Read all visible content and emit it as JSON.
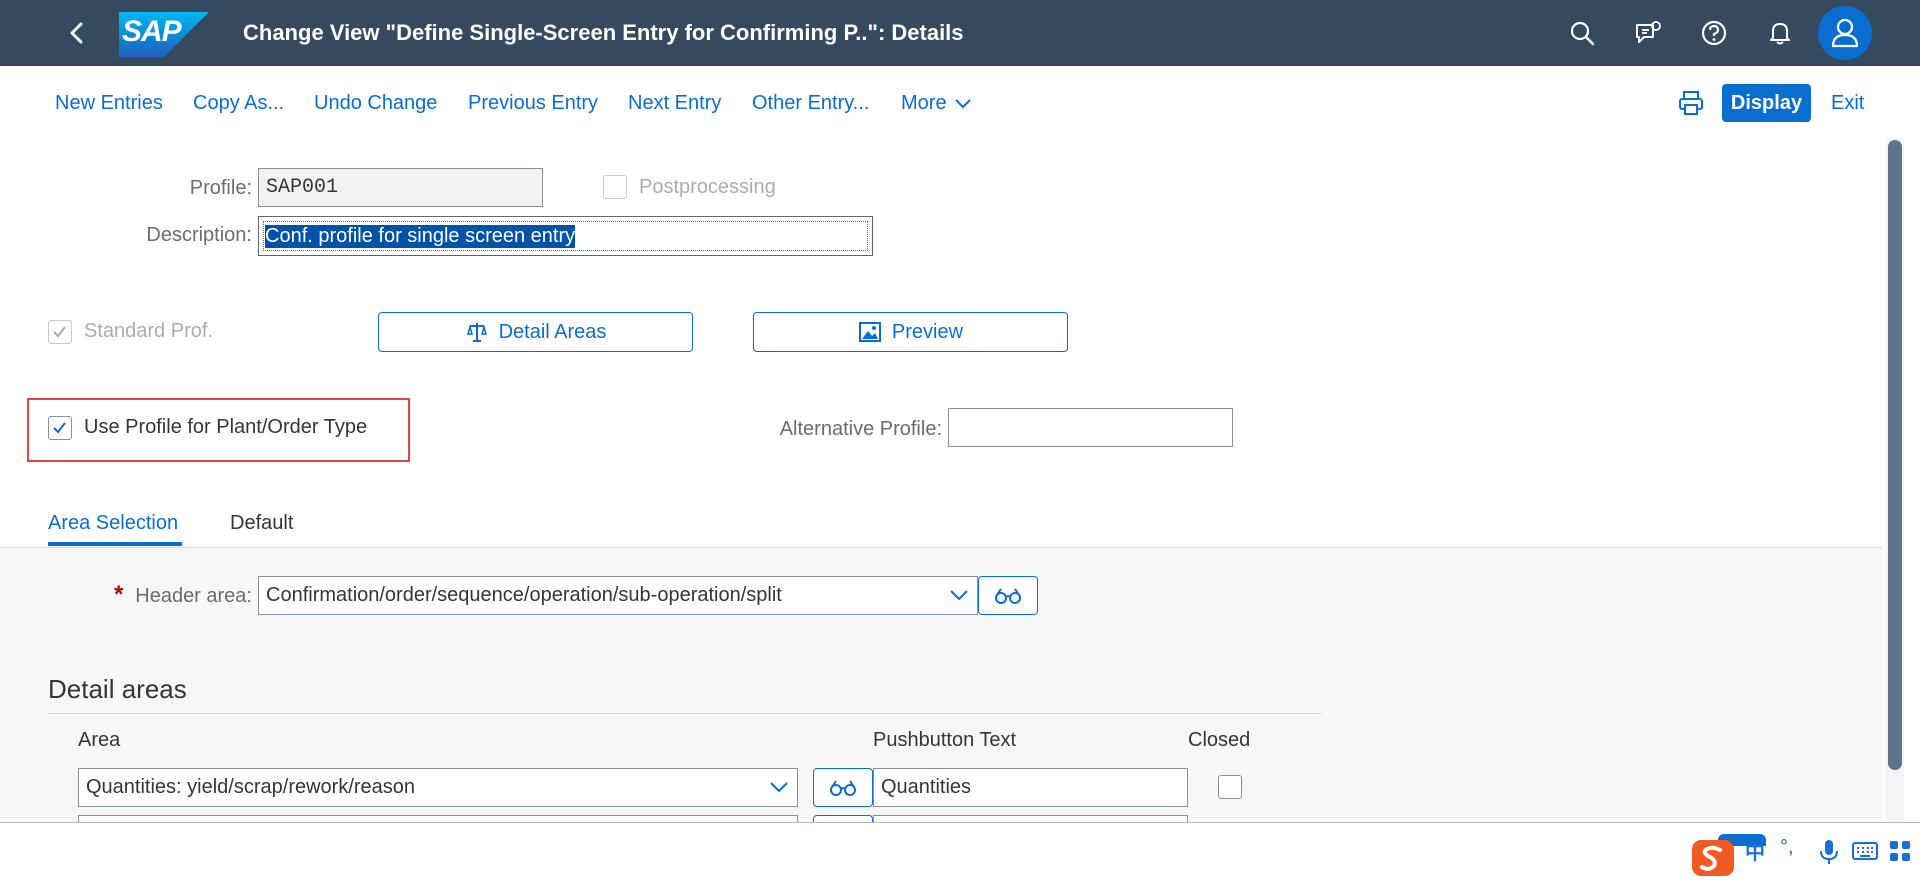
{
  "shell": {
    "logo_text": "SAP",
    "title": "Change View \"Define Single-Screen Entry for Confirming P..\": Details",
    "icons": [
      "back-icon",
      "search-icon",
      "feedback-icon",
      "help-icon",
      "notification-icon",
      "user-icon"
    ]
  },
  "toolbar": {
    "new_entries": "New Entries",
    "copy_as": "Copy As...",
    "undo_change": "Undo Change",
    "previous_entry": "Previous Entry",
    "next_entry": "Next Entry",
    "other_entry": "Other Entry...",
    "more": "More",
    "display": "Display",
    "exit": "Exit"
  },
  "form": {
    "profile_label": "Profile:",
    "profile_value": "SAP001",
    "postprocessing_label": "Postprocessing",
    "postprocessing_checked": false,
    "description_label": "Description:",
    "description_value": "Conf. profile for single screen entry",
    "standard_prof_label": "Standard Prof.",
    "standard_prof_checked": true,
    "detail_areas_button": "Detail Areas",
    "preview_button": "Preview",
    "use_profile_label": "Use Profile for Plant/Order Type",
    "use_profile_checked": true,
    "alternative_profile_label": "Alternative Profile:",
    "alternative_profile_value": ""
  },
  "tabs": [
    {
      "label": "Area Selection",
      "selected": true
    },
    {
      "label": "Default",
      "selected": false
    }
  ],
  "area_selection": {
    "required_marker": "*",
    "header_area_label": "Header area:",
    "header_area_value": "Confirmation/order/sequence/operation/sub-operation/split"
  },
  "detail_areas": {
    "title": "Detail areas",
    "columns": [
      "Area",
      "Pushbutton Text",
      "Closed"
    ],
    "rows": [
      {
        "area": "Quantities: yield/scrap/rework/reason",
        "pushbutton_text": "Quantities",
        "closed": false
      }
    ]
  },
  "ime": {
    "lang": "中",
    "punct": "°,"
  },
  "colors": {
    "shell_bg": "#354a5f",
    "accent": "#0a6ed1",
    "highlight_box": "#e0454b"
  }
}
